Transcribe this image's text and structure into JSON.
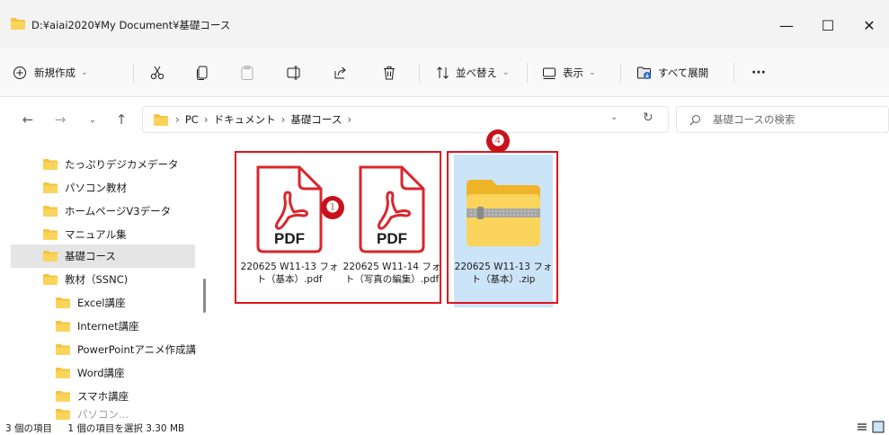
{
  "window": {
    "title": "D:¥aiai2020¥My Document¥基礎コース",
    "minimize_glyph": "—",
    "maximize_glyph": "☐",
    "close_glyph": "✕"
  },
  "toolbar": {
    "new_label": "新規作成",
    "sort_label": "並べ替え",
    "view_label": "表示",
    "extract_label": "すべて展開",
    "more_label": "···"
  },
  "address": {
    "crumbs": [
      "PC",
      "ドキュメント",
      "基礎コース"
    ],
    "search_placeholder": "基礎コースの検索"
  },
  "sidebar": {
    "items": [
      {
        "label": "たっぷりデジカメデータ"
      },
      {
        "label": "パソコン教材"
      },
      {
        "label": "ホームページV3データ"
      },
      {
        "label": "マニュアル集"
      },
      {
        "label": "基礎コース",
        "selected": true
      },
      {
        "label": "教材（SSNC)"
      },
      {
        "label": "Excel講座"
      },
      {
        "label": "Internet講座"
      },
      {
        "label": "PowerPointアニメ作成講"
      },
      {
        "label": "Word講座"
      },
      {
        "label": "スマホ講座"
      },
      {
        "label": "パソコン..."
      }
    ]
  },
  "files": [
    {
      "name": "220625 W11-13 フォト（基本）.pdf",
      "icon": "pdf-icon",
      "type_label": "PDF"
    },
    {
      "name": "220625 W11-14 フォト（写真の編集）.pdf",
      "icon": "pdf-icon",
      "type_label": "PDF"
    },
    {
      "name": "220625 W11-13 フォト（基本）.zip",
      "icon": "zip-folder-icon",
      "selected": true
    }
  ],
  "annotations": {
    "badge1": "❶",
    "badge4": "❹"
  },
  "status": {
    "count": "3 個の項目",
    "selection": "1 個の項目を選択  3.30 MB"
  },
  "colors": {
    "accent_red": "#e0141e",
    "pdf_red": "#d9262c",
    "folder_yellow": "#f5c342",
    "selection_blue": "#cce4f7"
  }
}
